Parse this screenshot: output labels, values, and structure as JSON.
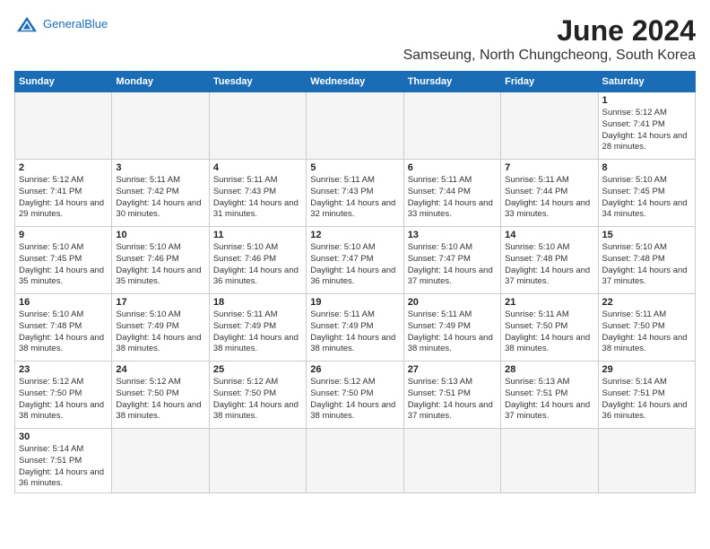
{
  "header": {
    "logo_general": "General",
    "logo_blue": "Blue",
    "title": "June 2024",
    "subtitle": "Samseung, North Chungcheong, South Korea"
  },
  "days_of_week": [
    "Sunday",
    "Monday",
    "Tuesday",
    "Wednesday",
    "Thursday",
    "Friday",
    "Saturday"
  ],
  "weeks": [
    [
      {
        "day": "",
        "sunrise": "",
        "sunset": "",
        "daylight": ""
      },
      {
        "day": "",
        "sunrise": "",
        "sunset": "",
        "daylight": ""
      },
      {
        "day": "",
        "sunrise": "",
        "sunset": "",
        "daylight": ""
      },
      {
        "day": "",
        "sunrise": "",
        "sunset": "",
        "daylight": ""
      },
      {
        "day": "",
        "sunrise": "",
        "sunset": "",
        "daylight": ""
      },
      {
        "day": "",
        "sunrise": "",
        "sunset": "",
        "daylight": ""
      },
      {
        "day": "1",
        "sunrise": "Sunrise: 5:12 AM",
        "sunset": "Sunset: 7:41 PM",
        "daylight": "Daylight: 14 hours and 28 minutes."
      }
    ],
    [
      {
        "day": "2",
        "sunrise": "Sunrise: 5:12 AM",
        "sunset": "Sunset: 7:41 PM",
        "daylight": "Daylight: 14 hours and 29 minutes."
      },
      {
        "day": "3",
        "sunrise": "Sunrise: 5:11 AM",
        "sunset": "Sunset: 7:42 PM",
        "daylight": "Daylight: 14 hours and 30 minutes."
      },
      {
        "day": "4",
        "sunrise": "Sunrise: 5:11 AM",
        "sunset": "Sunset: 7:43 PM",
        "daylight": "Daylight: 14 hours and 31 minutes."
      },
      {
        "day": "5",
        "sunrise": "Sunrise: 5:11 AM",
        "sunset": "Sunset: 7:43 PM",
        "daylight": "Daylight: 14 hours and 32 minutes."
      },
      {
        "day": "6",
        "sunrise": "Sunrise: 5:11 AM",
        "sunset": "Sunset: 7:44 PM",
        "daylight": "Daylight: 14 hours and 33 minutes."
      },
      {
        "day": "7",
        "sunrise": "Sunrise: 5:11 AM",
        "sunset": "Sunset: 7:44 PM",
        "daylight": "Daylight: 14 hours and 33 minutes."
      },
      {
        "day": "8",
        "sunrise": "Sunrise: 5:10 AM",
        "sunset": "Sunset: 7:45 PM",
        "daylight": "Daylight: 14 hours and 34 minutes."
      }
    ],
    [
      {
        "day": "9",
        "sunrise": "Sunrise: 5:10 AM",
        "sunset": "Sunset: 7:45 PM",
        "daylight": "Daylight: 14 hours and 35 minutes."
      },
      {
        "day": "10",
        "sunrise": "Sunrise: 5:10 AM",
        "sunset": "Sunset: 7:46 PM",
        "daylight": "Daylight: 14 hours and 35 minutes."
      },
      {
        "day": "11",
        "sunrise": "Sunrise: 5:10 AM",
        "sunset": "Sunset: 7:46 PM",
        "daylight": "Daylight: 14 hours and 36 minutes."
      },
      {
        "day": "12",
        "sunrise": "Sunrise: 5:10 AM",
        "sunset": "Sunset: 7:47 PM",
        "daylight": "Daylight: 14 hours and 36 minutes."
      },
      {
        "day": "13",
        "sunrise": "Sunrise: 5:10 AM",
        "sunset": "Sunset: 7:47 PM",
        "daylight": "Daylight: 14 hours and 37 minutes."
      },
      {
        "day": "14",
        "sunrise": "Sunrise: 5:10 AM",
        "sunset": "Sunset: 7:48 PM",
        "daylight": "Daylight: 14 hours and 37 minutes."
      },
      {
        "day": "15",
        "sunrise": "Sunrise: 5:10 AM",
        "sunset": "Sunset: 7:48 PM",
        "daylight": "Daylight: 14 hours and 37 minutes."
      }
    ],
    [
      {
        "day": "16",
        "sunrise": "Sunrise: 5:10 AM",
        "sunset": "Sunset: 7:48 PM",
        "daylight": "Daylight: 14 hours and 38 minutes."
      },
      {
        "day": "17",
        "sunrise": "Sunrise: 5:10 AM",
        "sunset": "Sunset: 7:49 PM",
        "daylight": "Daylight: 14 hours and 38 minutes."
      },
      {
        "day": "18",
        "sunrise": "Sunrise: 5:11 AM",
        "sunset": "Sunset: 7:49 PM",
        "daylight": "Daylight: 14 hours and 38 minutes."
      },
      {
        "day": "19",
        "sunrise": "Sunrise: 5:11 AM",
        "sunset": "Sunset: 7:49 PM",
        "daylight": "Daylight: 14 hours and 38 minutes."
      },
      {
        "day": "20",
        "sunrise": "Sunrise: 5:11 AM",
        "sunset": "Sunset: 7:49 PM",
        "daylight": "Daylight: 14 hours and 38 minutes."
      },
      {
        "day": "21",
        "sunrise": "Sunrise: 5:11 AM",
        "sunset": "Sunset: 7:50 PM",
        "daylight": "Daylight: 14 hours and 38 minutes."
      },
      {
        "day": "22",
        "sunrise": "Sunrise: 5:11 AM",
        "sunset": "Sunset: 7:50 PM",
        "daylight": "Daylight: 14 hours and 38 minutes."
      }
    ],
    [
      {
        "day": "23",
        "sunrise": "Sunrise: 5:12 AM",
        "sunset": "Sunset: 7:50 PM",
        "daylight": "Daylight: 14 hours and 38 minutes."
      },
      {
        "day": "24",
        "sunrise": "Sunrise: 5:12 AM",
        "sunset": "Sunset: 7:50 PM",
        "daylight": "Daylight: 14 hours and 38 minutes."
      },
      {
        "day": "25",
        "sunrise": "Sunrise: 5:12 AM",
        "sunset": "Sunset: 7:50 PM",
        "daylight": "Daylight: 14 hours and 38 minutes."
      },
      {
        "day": "26",
        "sunrise": "Sunrise: 5:12 AM",
        "sunset": "Sunset: 7:50 PM",
        "daylight": "Daylight: 14 hours and 38 minutes."
      },
      {
        "day": "27",
        "sunrise": "Sunrise: 5:13 AM",
        "sunset": "Sunset: 7:51 PM",
        "daylight": "Daylight: 14 hours and 37 minutes."
      },
      {
        "day": "28",
        "sunrise": "Sunrise: 5:13 AM",
        "sunset": "Sunset: 7:51 PM",
        "daylight": "Daylight: 14 hours and 37 minutes."
      },
      {
        "day": "29",
        "sunrise": "Sunrise: 5:14 AM",
        "sunset": "Sunset: 7:51 PM",
        "daylight": "Daylight: 14 hours and 36 minutes."
      }
    ],
    [
      {
        "day": "30",
        "sunrise": "Sunrise: 5:14 AM",
        "sunset": "Sunset: 7:51 PM",
        "daylight": "Daylight: 14 hours and 36 minutes."
      },
      {
        "day": "",
        "sunrise": "",
        "sunset": "",
        "daylight": ""
      },
      {
        "day": "",
        "sunrise": "",
        "sunset": "",
        "daylight": ""
      },
      {
        "day": "",
        "sunrise": "",
        "sunset": "",
        "daylight": ""
      },
      {
        "day": "",
        "sunrise": "",
        "sunset": "",
        "daylight": ""
      },
      {
        "day": "",
        "sunrise": "",
        "sunset": "",
        "daylight": ""
      },
      {
        "day": "",
        "sunrise": "",
        "sunset": "",
        "daylight": ""
      }
    ]
  ]
}
